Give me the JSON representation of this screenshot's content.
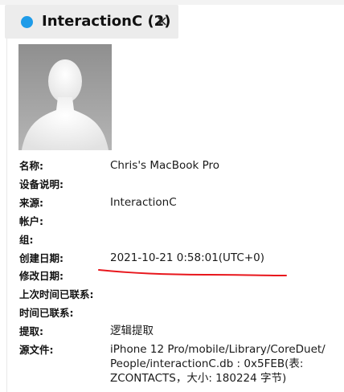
{
  "tab": {
    "title": "InteractionC (2)",
    "close_glyph": "×",
    "dot_color": "#1e9be8"
  },
  "avatar": {
    "icon": "person-silhouette-icon"
  },
  "properties": [
    {
      "label": "名称:",
      "value": "Chris's MacBook Pro"
    },
    {
      "label": "设备说明:",
      "value": ""
    },
    {
      "label": "来源:",
      "value": "InteractionC"
    },
    {
      "label": "帐户:",
      "value": ""
    },
    {
      "label": "组:",
      "value": ""
    },
    {
      "label": "创建日期:",
      "value": "2021-10-21 0:58:01(UTC+0)"
    },
    {
      "label": "修改日期:",
      "value": ""
    },
    {
      "label": "上次时间已联系:",
      "value": ""
    },
    {
      "label": "时间已联系:",
      "value": ""
    },
    {
      "label": "提取:",
      "value": "逻辑提取"
    },
    {
      "label": "源文件:",
      "value": [
        "iPhone 12 Pro/mobile/Library/CoreDuet/",
        "People/interactionC.db : 0x5FEB(表:",
        "ZCONTACTS，大小: 180224 字节)"
      ]
    }
  ],
  "annotation": {
    "color": "#e8161c"
  }
}
